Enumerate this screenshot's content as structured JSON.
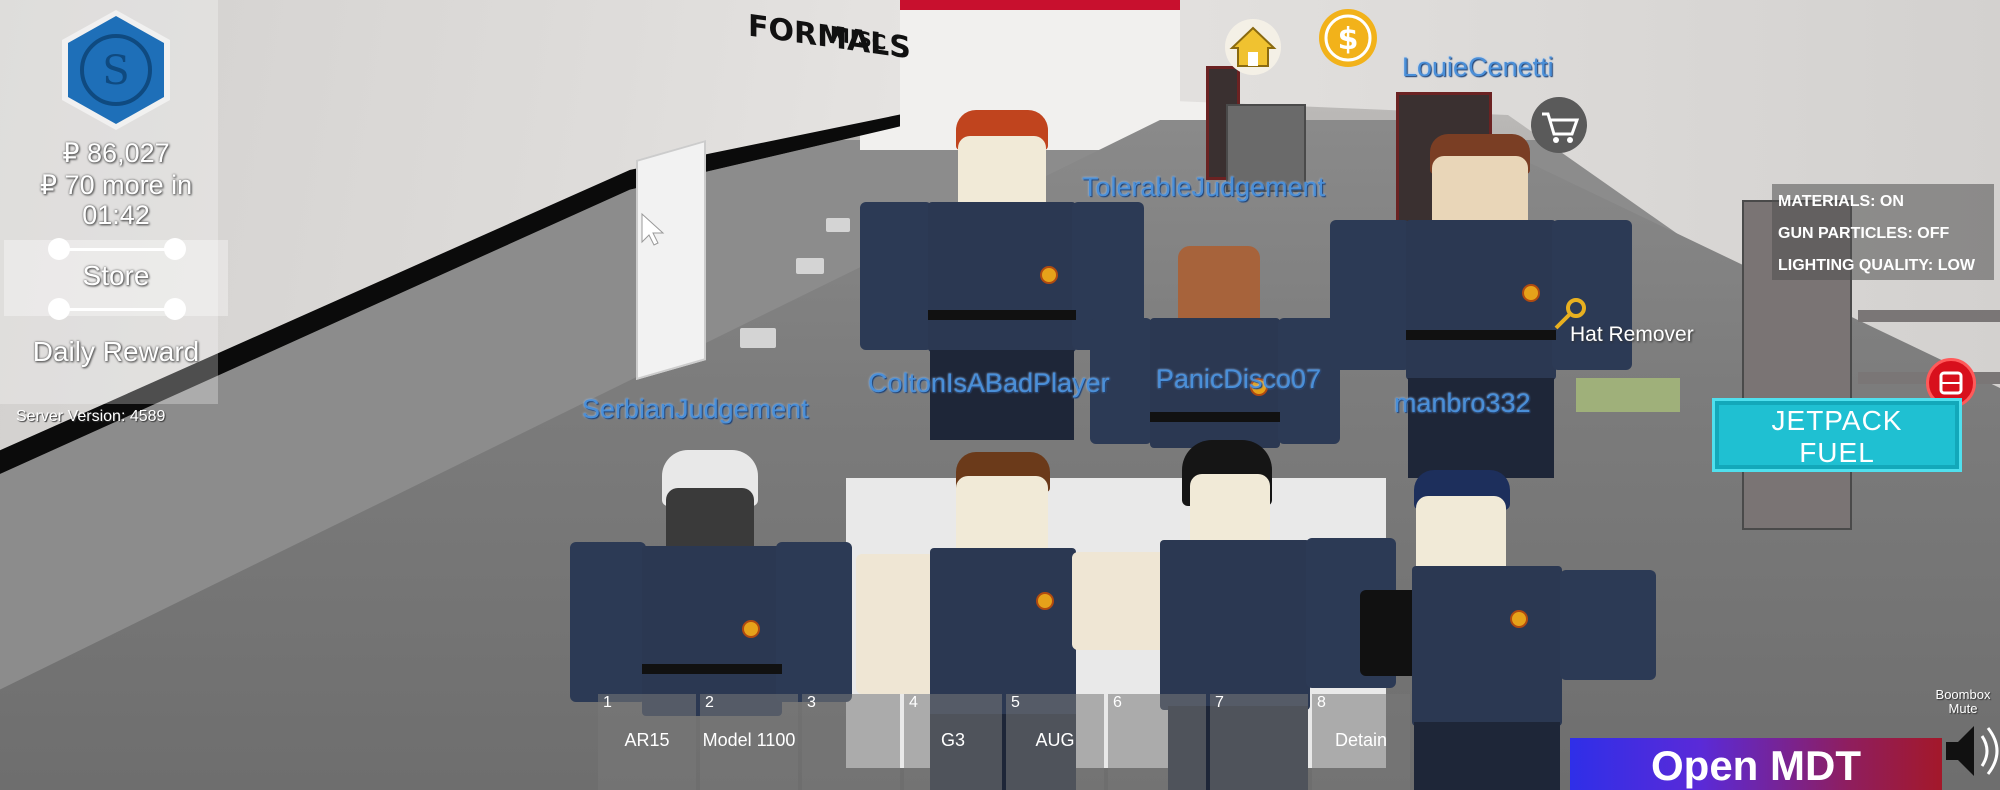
{
  "hud": {
    "cash": "₽ 86,027",
    "next_payout_line1": "₽ 70 more in",
    "next_payout_line2": "01:42",
    "store_label": "Store",
    "daily_reward_label": "Daily Reward",
    "server_version": "Server Version: 4589",
    "logo_icon": "s-hexagon-logo-icon"
  },
  "top_icons": {
    "home_icon": "house-icon",
    "currency_icon": "dollar-coin-icon",
    "cart_icon": "shopping-cart-icon"
  },
  "players": [
    {
      "name": "LouieCenetti"
    },
    {
      "name": "TolerableJudgement"
    },
    {
      "name": "ColtonIsABadPlayer"
    },
    {
      "name": "PanicDisco07"
    },
    {
      "name": "SerbianJudgement"
    },
    {
      "name": "manbro332"
    }
  ],
  "settings": [
    {
      "label": "MATERIALS: ON"
    },
    {
      "label": "GUN PARTICLES: OFF"
    },
    {
      "label": "LIGHTING QUALITY: LOW"
    }
  ],
  "world_labels": {
    "hat_remover": "Hat Remover",
    "wall_sign_1": "FORMALS",
    "wall_sign_2": "MISC"
  },
  "jetpack": {
    "line1": "JETPACK",
    "line2": "FUEL"
  },
  "hotbar": [
    {
      "slot": "1",
      "item": "AR15"
    },
    {
      "slot": "2",
      "item": "Model 1100"
    },
    {
      "slot": "3",
      "item": ""
    },
    {
      "slot": "4",
      "item": "G3"
    },
    {
      "slot": "5",
      "item": "AUG"
    },
    {
      "slot": "6",
      "item": ""
    },
    {
      "slot": "7",
      "item": ""
    },
    {
      "slot": "8",
      "item": "Detain"
    }
  ],
  "boombox": {
    "line1": "Boombox",
    "line2": "Mute"
  },
  "mdt_button": "Open MDT",
  "colors": {
    "name_tag": "#4a8fd8",
    "jetpack": "#1fc0d2",
    "mdt_start": "#2f2fe8",
    "mdt_end": "#a3182a",
    "uniform": "#2b3852"
  }
}
